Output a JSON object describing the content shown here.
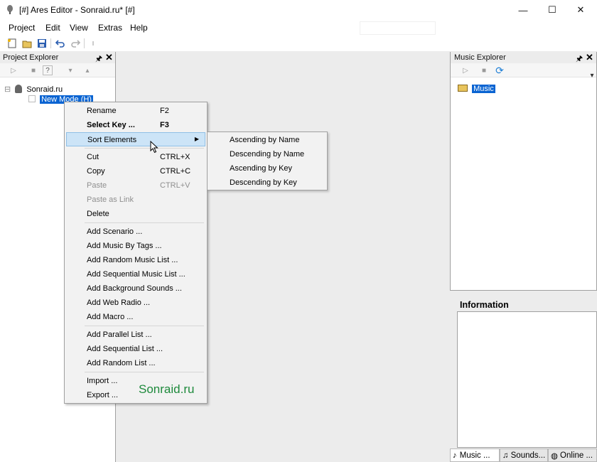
{
  "window": {
    "title": "[#] Ares Editor - Sonraid.ru* [#]",
    "icon": "microphone-icon",
    "minimize_glyph": "—",
    "maximize_glyph": "☐",
    "close_glyph": "✕"
  },
  "menubar": {
    "items": [
      "Project",
      "Edit",
      "View",
      "Extras",
      "Help"
    ]
  },
  "toolbar": {
    "icons": [
      "new-icon",
      "open-icon",
      "save-icon",
      "undo-icon",
      "redo-icon"
    ]
  },
  "project_explorer": {
    "title": "Project Explorer",
    "pin": "🖈",
    "close": "✕",
    "tree": {
      "root_expander": "⊟",
      "root_label": "Sonraid.ru",
      "child_label": "New Mode (H)"
    }
  },
  "context_menu": {
    "items": [
      {
        "label": "Rename",
        "shortcut": "F2"
      },
      {
        "label": "Select Key ...",
        "shortcut": "F3"
      },
      {
        "label": "Sort Elements",
        "shortcut": ""
      },
      {
        "label": "Cut",
        "shortcut": "CTRL+X"
      },
      {
        "label": "Copy",
        "shortcut": "CTRL+C"
      },
      {
        "label": "Paste",
        "shortcut": "CTRL+V"
      },
      {
        "label": "Paste as Link",
        "shortcut": ""
      },
      {
        "label": "Delete",
        "shortcut": ""
      },
      {
        "label": "Add Scenario ...",
        "shortcut": ""
      },
      {
        "label": "Add Music By Tags ...",
        "shortcut": ""
      },
      {
        "label": "Add Random Music List ...",
        "shortcut": ""
      },
      {
        "label": "Add Sequential Music List ...",
        "shortcut": ""
      },
      {
        "label": "Add Background Sounds ...",
        "shortcut": ""
      },
      {
        "label": "Add Web Radio ...",
        "shortcut": ""
      },
      {
        "label": "Add Macro ...",
        "shortcut": ""
      },
      {
        "label": "Add Parallel List ...",
        "shortcut": ""
      },
      {
        "label": "Add Sequential List ...",
        "shortcut": ""
      },
      {
        "label": "Add Random List ...",
        "shortcut": ""
      },
      {
        "label": "Import ...",
        "shortcut": ""
      },
      {
        "label": "Export ...",
        "shortcut": ""
      }
    ],
    "submenu_arrow": "▶"
  },
  "submenu": {
    "items": [
      "Ascending by Name",
      "Descending by Name",
      "Ascending by Key",
      "Descending by Key"
    ]
  },
  "music_explorer": {
    "title": "Music Explorer",
    "pin": "🖈",
    "close": "✕",
    "tree_label": "Music"
  },
  "information": {
    "title": "Information"
  },
  "bottom_tabs": [
    "Music ...",
    "Sounds...",
    "Online ..."
  ],
  "watermark": "Sonraid.ru",
  "colors": {
    "selection": "#0a64d2",
    "highlight": "#cce4f7",
    "watermark": "#1e8a3c"
  }
}
